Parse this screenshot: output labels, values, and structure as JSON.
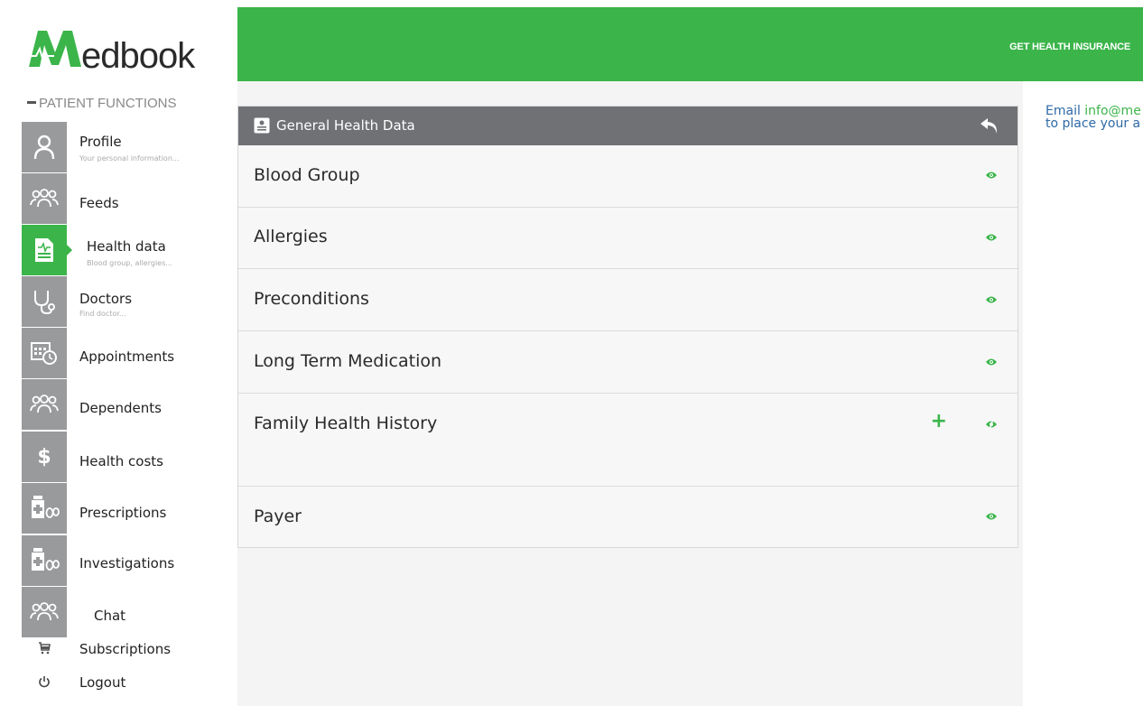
{
  "logo": {
    "m": "M",
    "text": "edbook"
  },
  "sidebar": {
    "section_label": "PATIENT FUNCTIONS",
    "items": [
      {
        "label": "Profile",
        "sub": "Your personal information...",
        "icon": "person-icon"
      },
      {
        "label": "Feeds",
        "sub": "",
        "icon": "group-icon"
      },
      {
        "label": "Health data",
        "sub": "Blood group, allergies...",
        "icon": "health-doc-icon"
      },
      {
        "label": "Doctors",
        "sub": "Find doctor...",
        "icon": "stethoscope-icon"
      },
      {
        "label": "Appointments",
        "sub": "",
        "icon": "calendar-clock-icon"
      },
      {
        "label": "Dependents",
        "sub": "",
        "icon": "group-icon"
      },
      {
        "label": "Health costs",
        "sub": "",
        "icon": "dollar-icon"
      },
      {
        "label": "Prescriptions",
        "sub": "",
        "icon": "pills-icon"
      },
      {
        "label": "Investigations",
        "sub": "",
        "icon": "pills-icon"
      },
      {
        "label": "Chat",
        "sub": "",
        "icon": "group-icon"
      },
      {
        "label": "Subscriptions",
        "sub": "",
        "icon": "cart-icon"
      },
      {
        "label": "Logout",
        "sub": "",
        "icon": "power-icon"
      }
    ]
  },
  "header": {
    "insurance": "GET HEALTH INSURANCE"
  },
  "panel": {
    "title": "General Health Data",
    "rows": [
      {
        "label": "Blood Group"
      },
      {
        "label": "Allergies"
      },
      {
        "label": "Preconditions"
      },
      {
        "label": "Long Term Medication"
      },
      {
        "label": "Family Health History"
      },
      {
        "label": "Payer"
      }
    ]
  },
  "promo": {
    "line1_prefix": "Email ",
    "email": "info@me",
    "line2": "to place your a"
  },
  "colors": {
    "accent": "#3bb54a",
    "sidebar_icon": "#999a9c",
    "panel_head": "#6f7175",
    "brand_blue": "#2e6aa7"
  }
}
